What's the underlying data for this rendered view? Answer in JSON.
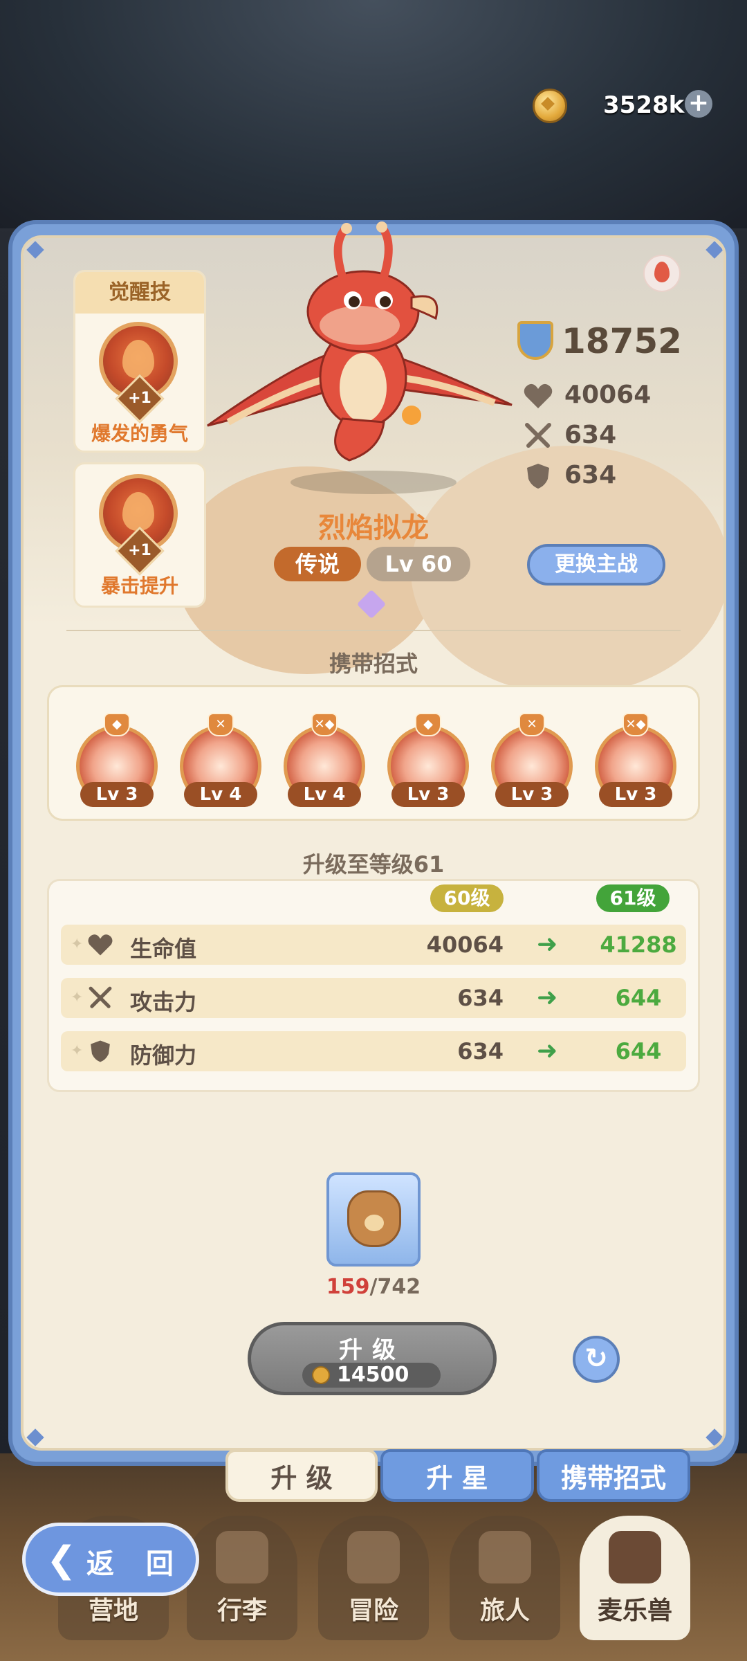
{
  "currency": {
    "amount": "3528k",
    "plus": "+"
  },
  "awakening": {
    "title": "觉醒技",
    "skills": [
      {
        "plus": "+1",
        "name": "爆发的勇气",
        "icon": "flame-bird-icon"
      },
      {
        "plus": "+1",
        "name": "暴击提升",
        "icon": "dragon-head-icon"
      }
    ]
  },
  "monster": {
    "name": "烈焰拟龙",
    "rarity": "传说",
    "level": "Lv 60",
    "element_icon": "fire-icon",
    "switch_label": "更换主战"
  },
  "stats": {
    "power": "18752",
    "hp": "40064",
    "attack": "634",
    "defense": "634"
  },
  "moves": {
    "title": "携带招式",
    "items": [
      {
        "emblem": "shield",
        "level": "Lv 3"
      },
      {
        "emblem": "swords",
        "level": "Lv 4"
      },
      {
        "emblem": "swords-shield",
        "level": "Lv 4"
      },
      {
        "emblem": "shield",
        "level": "Lv 3"
      },
      {
        "emblem": "swords",
        "level": "Lv 3"
      },
      {
        "emblem": "swords-shield",
        "level": "Lv 3"
      }
    ]
  },
  "upgrade": {
    "title": "升级至等级61",
    "from_level": "60级",
    "to_level": "61级",
    "rows": [
      {
        "label": "生命值",
        "old": "40064",
        "new": "41288",
        "icon": "heart-icon"
      },
      {
        "label": "攻击力",
        "old": "634",
        "new": "644",
        "icon": "swords-icon"
      },
      {
        "label": "防御力",
        "old": "634",
        "new": "644",
        "icon": "shield-icon"
      }
    ]
  },
  "material": {
    "have": "159",
    "separator": "/",
    "need": "742",
    "icon": "food-bag-icon"
  },
  "upgrade_button": {
    "label": "升级",
    "cost": "14500"
  },
  "tabs": [
    {
      "label": "升 级",
      "active": true
    },
    {
      "label": "升 星",
      "active": false
    },
    {
      "label": "携带招式",
      "active": false
    }
  ],
  "back_button": {
    "label": "返 回"
  },
  "bottom_nav": [
    {
      "label": "营地",
      "active": false
    },
    {
      "label": "行李",
      "active": false
    },
    {
      "label": "冒险",
      "active": false
    },
    {
      "label": "旅人",
      "active": false
    },
    {
      "label": "麦乐兽",
      "active": true
    }
  ],
  "colors": {
    "panel_blue": "#7aa0d8",
    "panel_cream": "#f4eddd",
    "accent_orange": "#e8873a",
    "increase_green": "#4caa3f",
    "insufficient_red": "#d0413a"
  }
}
